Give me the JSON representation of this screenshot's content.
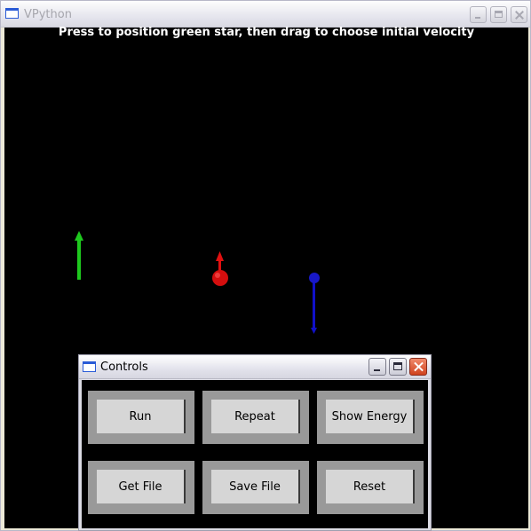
{
  "window": {
    "title": "VPython"
  },
  "canvas": {
    "instruction": "Press to position green star, then drag to choose initial velocity"
  },
  "scene": {
    "colors": {
      "background": "#000000",
      "green": "#1ec81e",
      "red": "#e01010",
      "blue": "#1010c8"
    }
  },
  "controls": {
    "title": "Controls",
    "buttons": [
      "Run",
      "Repeat",
      "Show Energy",
      "Get File",
      "Save File",
      "Reset"
    ]
  }
}
